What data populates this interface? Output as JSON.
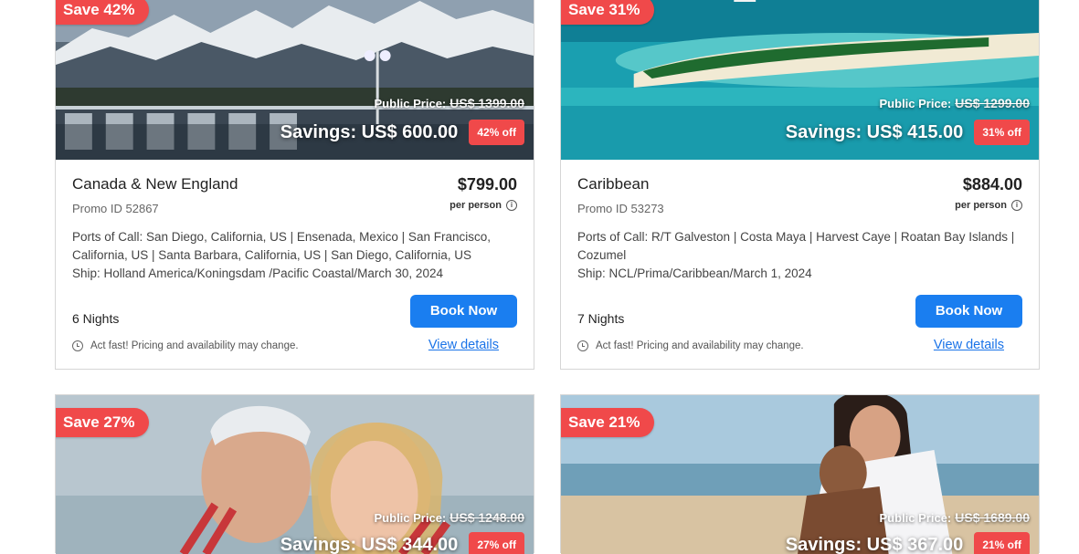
{
  "cards": [
    {
      "save_label": "Save 42%",
      "public_price_label": "Public Price:",
      "public_price": "US$ 1399.00",
      "savings": "Savings: US$ 600.00",
      "off": "42% off",
      "destination": "Canada & New England",
      "price": "$799.00",
      "promo": "Promo ID 52867",
      "per_person": "per person",
      "ports": "Ports of Call: San Diego, California, US | Ensenada, Mexico | San Francisco, California, US | Santa Barbara, California, US | San Diego, California, US",
      "ship": "Ship: Holland America/Koningsdam /Pacific Coastal/March 30, 2024",
      "nights": "6 Nights",
      "book": "Book Now",
      "act_fast": "Act fast! Pricing and availability may change.",
      "view_details": "View details"
    },
    {
      "save_label": "Save 31%",
      "public_price_label": "Public Price:",
      "public_price": "US$ 1299.00",
      "savings": "Savings: US$ 415.00",
      "off": "31% off",
      "destination": "Caribbean",
      "price": "$884.00",
      "promo": "Promo ID 53273",
      "per_person": "per person",
      "ports": "Ports of Call: R/T Galveston | Costa Maya | Harvest Caye | Roatan Bay Islands | Cozumel",
      "ship": "Ship: NCL/Prima/Caribbean/March 1, 2024",
      "nights": "7 Nights",
      "book": "Book Now",
      "act_fast": "Act fast! Pricing and availability may change.",
      "view_details": "View details"
    },
    {
      "save_label": "Save 27%",
      "public_price_label": "Public Price:",
      "public_price": "US$ 1248.00",
      "savings": "Savings: US$ 344.00",
      "off": "27% off"
    },
    {
      "save_label": "Save 21%",
      "public_price_label": "Public Price:",
      "public_price": "US$ 1689.00",
      "savings": "Savings: US$ 367.00",
      "off": "21% off"
    }
  ]
}
